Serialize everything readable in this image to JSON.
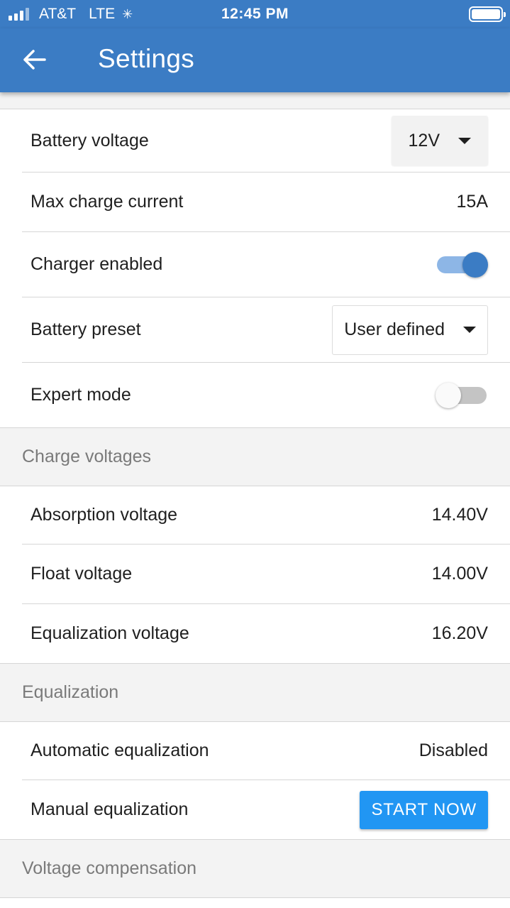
{
  "status_bar": {
    "carrier": "AT&T",
    "network": "LTE",
    "time": "12:45 PM"
  },
  "app_bar": {
    "title": "Settings",
    "back_icon": "arrow-left-icon"
  },
  "colors": {
    "primary": "#3b7cc4",
    "button": "#2196f3",
    "section_bg": "#f3f3f3"
  },
  "settings": {
    "battery_voltage": {
      "label": "Battery voltage",
      "value": "12V"
    },
    "max_charge_current": {
      "label": "Max charge current",
      "value": "15A"
    },
    "charger_enabled": {
      "label": "Charger enabled",
      "state": "on"
    },
    "battery_preset": {
      "label": "Battery preset",
      "value": "User defined"
    },
    "expert_mode": {
      "label": "Expert mode",
      "state": "off"
    }
  },
  "charge_voltages": {
    "header": "Charge voltages",
    "absorption": {
      "label": "Absorption voltage",
      "value": "14.40V"
    },
    "float": {
      "label": "Float voltage",
      "value": "14.00V"
    },
    "equalization": {
      "label": "Equalization voltage",
      "value": "16.20V"
    }
  },
  "equalization": {
    "header": "Equalization",
    "automatic": {
      "label": "Automatic equalization",
      "value": "Disabled"
    },
    "manual": {
      "label": "Manual equalization",
      "button": "START NOW"
    }
  },
  "voltage_compensation": {
    "header": "Voltage compensation"
  }
}
